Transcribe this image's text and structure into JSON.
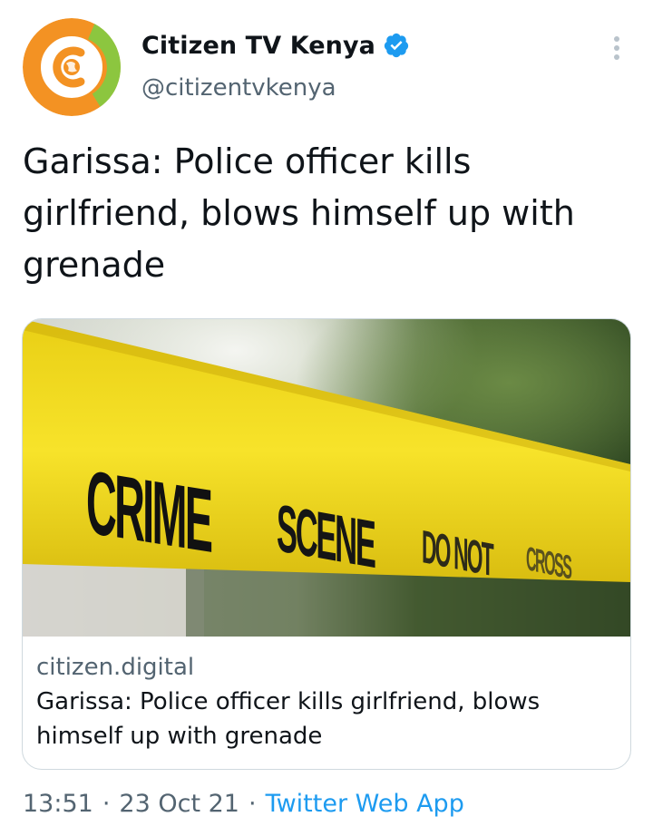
{
  "author": {
    "display_name": "Citizen TV Kenya",
    "handle": "@citizentvkenya",
    "verified": true,
    "avatar": "citizen-tv-logo"
  },
  "tweet": {
    "text": "Garissa: Police officer kills girlfriend, blows himself up with grenade"
  },
  "card": {
    "image_tape_text": "CRIME SCENE DO NOT CROSS",
    "domain": "citizen.digital",
    "title": "Garissa: Police officer kills girlfriend, blows himself up with grenade"
  },
  "meta": {
    "time": "13:51",
    "separator": "·",
    "date": "23 Oct 21",
    "source": "Twitter Web App"
  },
  "colors": {
    "accent": "#1d9bf0",
    "secondary_text": "#536471",
    "logo_orange": "#f39223",
    "logo_green": "#8cc63f",
    "tape_yellow": "#f4dc1c"
  },
  "icons": {
    "verified": "verified-badge-icon",
    "more": "more-options-icon"
  }
}
